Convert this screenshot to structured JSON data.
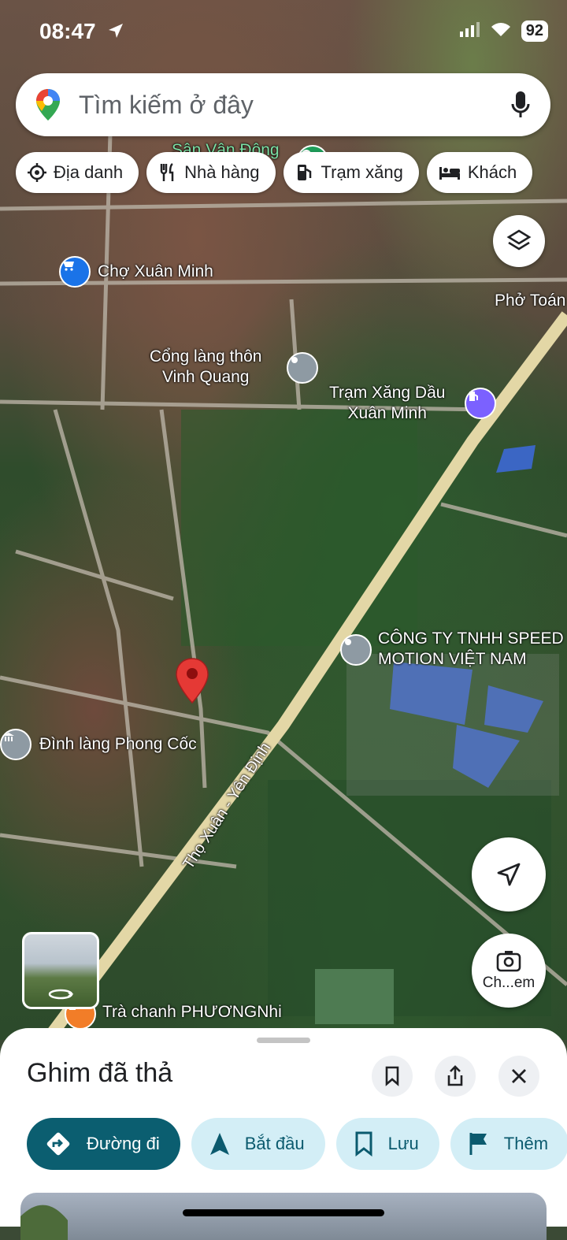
{
  "status": {
    "time": "08:47",
    "battery": "92"
  },
  "search": {
    "placeholder": "Tìm kiếm ở đây"
  },
  "chips": [
    {
      "label": "Địa danh",
      "icon": "landmark-icon"
    },
    {
      "label": "Nhà hàng",
      "icon": "restaurant-icon"
    },
    {
      "label": "Trạm xăng",
      "icon": "gas-station-icon"
    },
    {
      "label": "Khách",
      "icon": "hotel-icon"
    }
  ],
  "map": {
    "labels": {
      "stadium": "Sân Vận Động",
      "market": "Chợ Xuân Minh",
      "pho": "Phở Toán",
      "village_gate_1": "Cổng làng thôn",
      "village_gate_2": "Vinh Quang",
      "gas_1": "Trạm Xăng Dầu",
      "gas_2": "Xuân Minh",
      "company_1": "CÔNG TY TNHH SPEED",
      "company_2": "MOTION VIỆT NAM",
      "temple": "Đình làng Phong Cốc",
      "road": "Thọ Xuân - Yên Định",
      "tea": "Trà chanh PHƯƠNGNhi"
    },
    "camera_label": "Ch...em"
  },
  "sheet": {
    "title": "Ghim đã thả",
    "actions": [
      {
        "label": "Đường đi",
        "icon": "directions-icon"
      },
      {
        "label": "Bắt đầu",
        "icon": "navigation-arrow-icon"
      },
      {
        "label": "Lưu",
        "icon": "bookmark-icon"
      },
      {
        "label": "Thêm",
        "icon": "flag-icon"
      }
    ]
  },
  "colors": {
    "primary": "#0b5e70",
    "secondary_bg": "#d3eef6",
    "pin": "#e53935"
  }
}
